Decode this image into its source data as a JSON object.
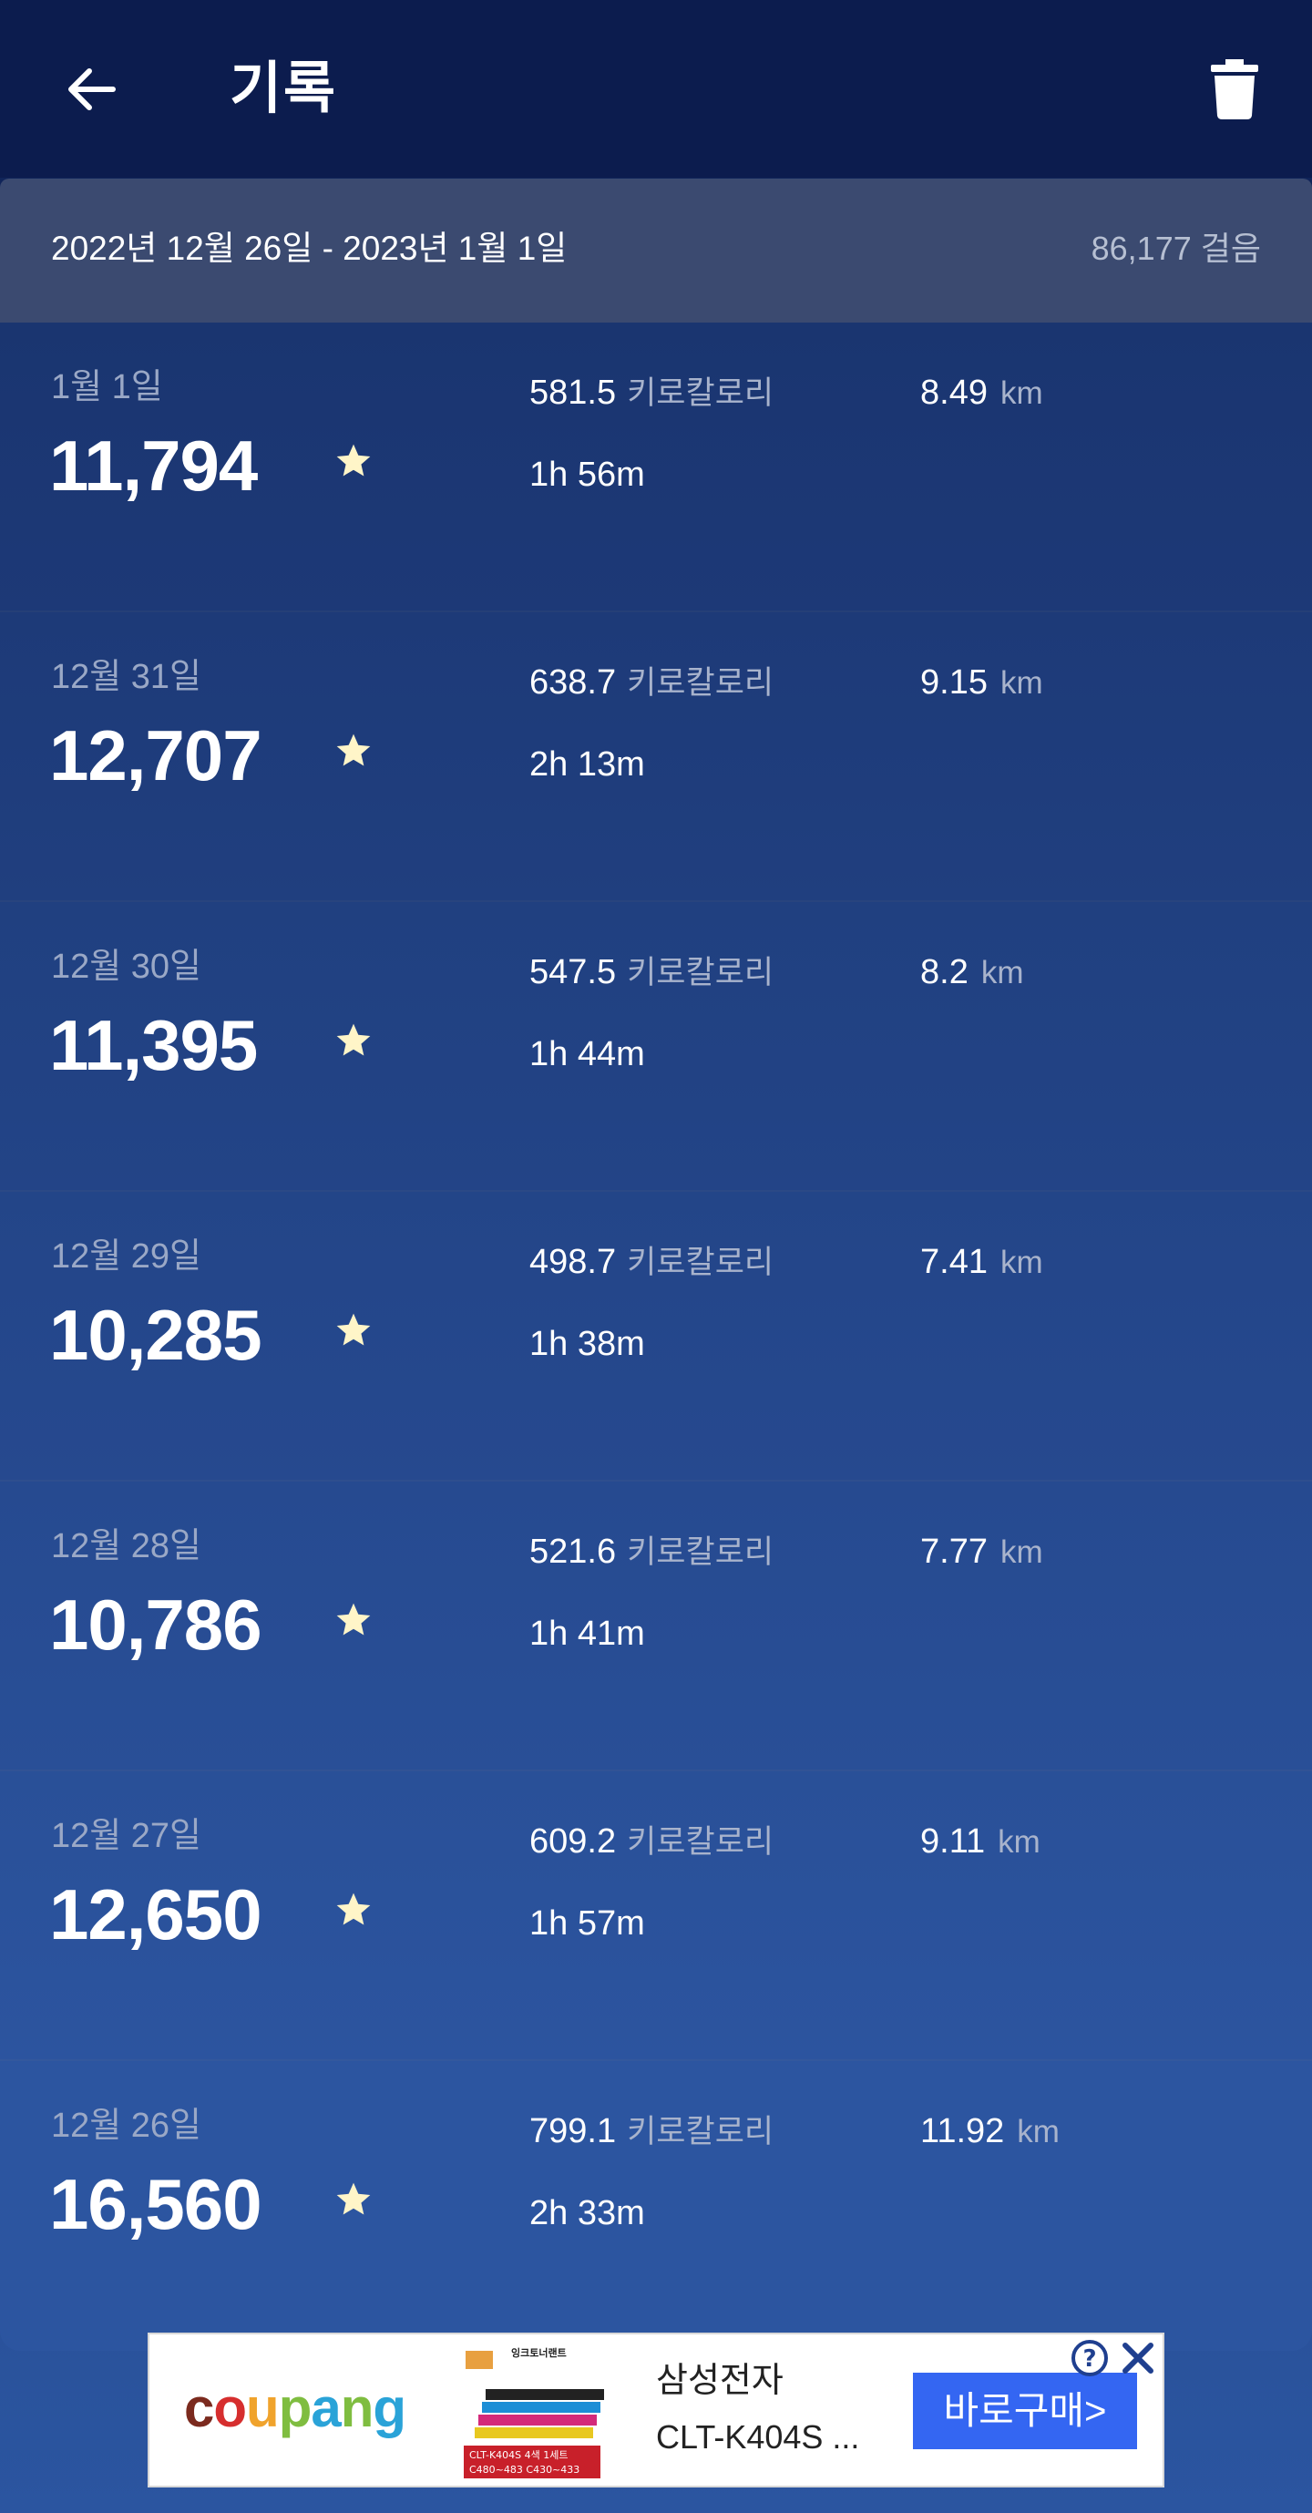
{
  "header": {
    "title": "기록",
    "back_icon": "arrow-left-icon",
    "delete_icon": "trash-icon"
  },
  "summary": {
    "date_range": "2022년 12월 26일 - 2023년 1월 1일",
    "total_steps": "86,177 걸음"
  },
  "records": [
    {
      "date": "1월 1일",
      "steps": "11,794",
      "kcal": "581.5",
      "kcal_unit": "키로칼로리",
      "duration": "1h 56m",
      "distance": "8.49",
      "distance_unit": "km"
    },
    {
      "date": "12월 31일",
      "steps": "12,707",
      "kcal": "638.7",
      "kcal_unit": "키로칼로리",
      "duration": "2h 13m",
      "distance": "9.15",
      "distance_unit": "km"
    },
    {
      "date": "12월 30일",
      "steps": "11,395",
      "kcal": "547.5",
      "kcal_unit": "키로칼로리",
      "duration": "1h 44m",
      "distance": "8.2",
      "distance_unit": "km"
    },
    {
      "date": "12월 29일",
      "steps": "10,285",
      "kcal": "498.7",
      "kcal_unit": "키로칼로리",
      "duration": "1h 38m",
      "distance": "7.41",
      "distance_unit": "km"
    },
    {
      "date": "12월 28일",
      "steps": "10,786",
      "kcal": "521.6",
      "kcal_unit": "키로칼로리",
      "duration": "1h 41m",
      "distance": "7.77",
      "distance_unit": "km"
    },
    {
      "date": "12월 27일",
      "steps": "12,650",
      "kcal": "609.2",
      "kcal_unit": "키로칼로리",
      "duration": "1h 57m",
      "distance": "9.11",
      "distance_unit": "km"
    },
    {
      "date": "12월 26일",
      "steps": "16,560",
      "kcal": "799.1",
      "kcal_unit": "키로칼로리",
      "duration": "2h 33m",
      "distance": "11.92",
      "distance_unit": "km"
    }
  ],
  "colors": {
    "star": "#fff5c8",
    "row_gradient_top": "#1a3570",
    "row_gradient_bottom": "#2c55a0",
    "coupang_c": "#7b2a1e",
    "coupang_o": "#d62e2e",
    "coupang_u": "#f0a32c",
    "coupang_p": "#7fbd40",
    "coupang_a": "#2aa3d8",
    "coupang_n": "#7fbd40",
    "coupang_g": "#2aa3d8",
    "ad_button": "#3466f2"
  },
  "ad": {
    "brand": "coupang",
    "product_title": "삼성전자",
    "product_subtitle": "CLT-K404S ...",
    "buy_label": "바로구매>",
    "image_top_text": "잉크토너랜트",
    "image_bottom_text_1": "CLT-K404S 4색 1세트",
    "image_bottom_text_2": "C480~483 C430~433",
    "help_icon": "question-circle-icon",
    "close_icon": "close-icon"
  }
}
